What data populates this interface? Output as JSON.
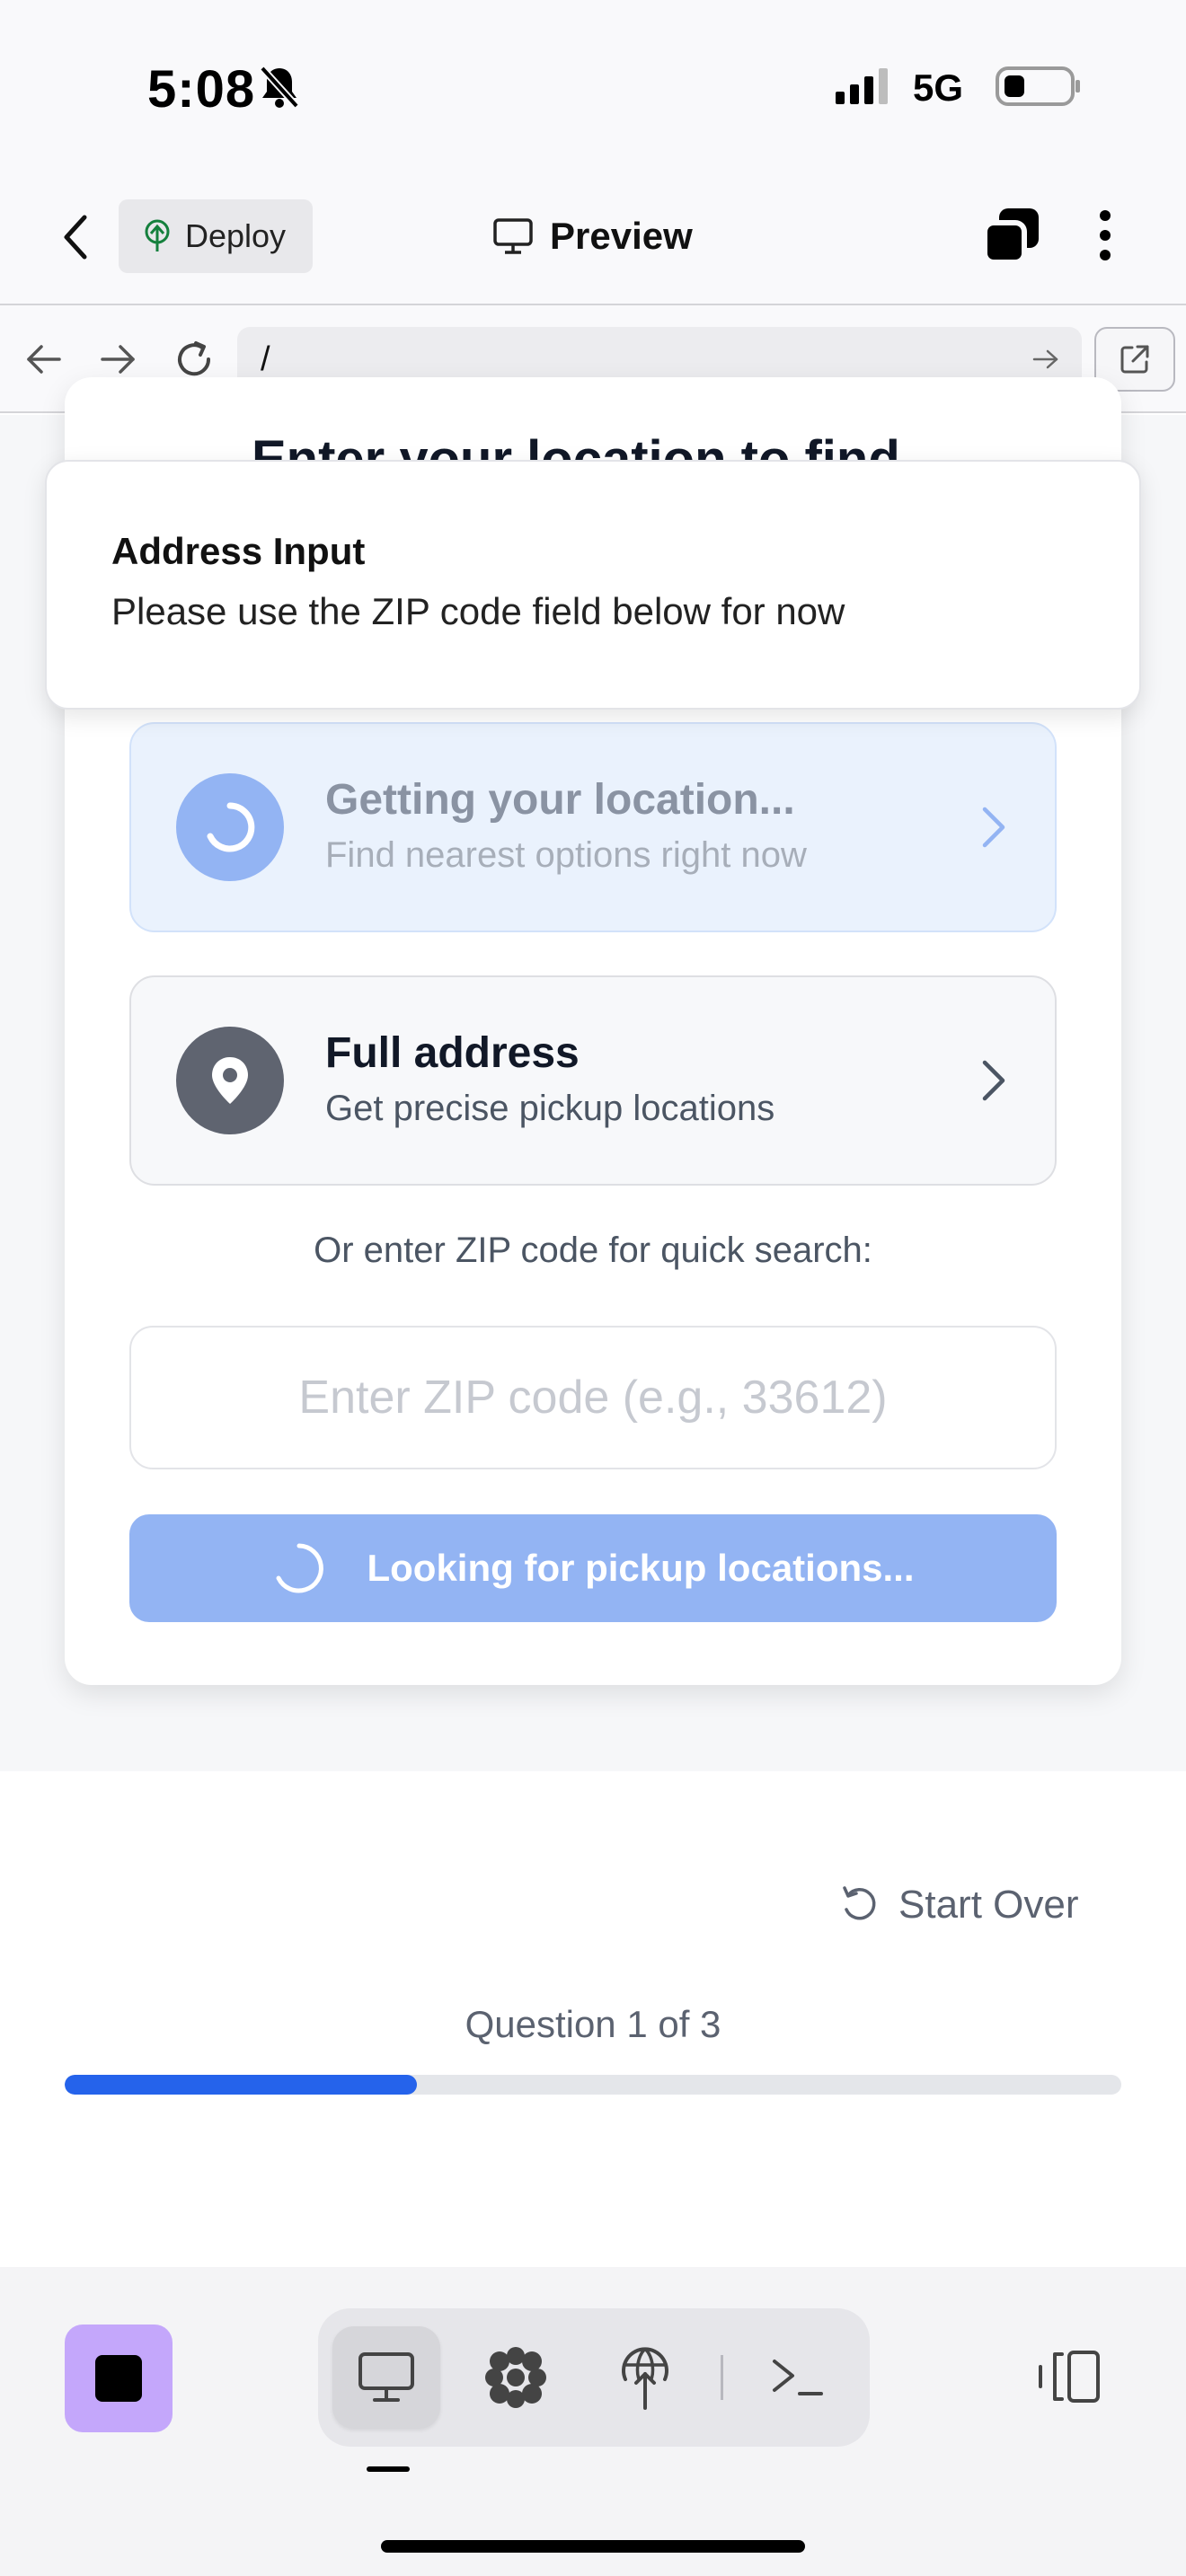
{
  "status_bar": {
    "time": "5:08",
    "network": "5G"
  },
  "header": {
    "deploy_label": "Deploy",
    "title": "Preview"
  },
  "browser": {
    "url": "/"
  },
  "card": {
    "title": "Enter your location to find",
    "geo_option": {
      "title": "Getting your location...",
      "subtitle": "Find nearest options right now"
    },
    "address_option": {
      "title": "Full address",
      "subtitle": "Get precise pickup locations"
    },
    "zip_label": "Or enter ZIP code for quick search:",
    "zip_input": {
      "value": "",
      "placeholder": "Enter ZIP code (e.g., 33612)"
    },
    "search_button_label": "Looking for pickup locations..."
  },
  "toast": {
    "title": "Address Input",
    "message": "Please use the ZIP code field below for now"
  },
  "footer": {
    "start_over_label": "Start Over",
    "question_counter": "Question 1 of 3",
    "progress_percent": 33.3
  },
  "colors": {
    "accent": "#2563eb",
    "button_disabled": "#93b4f3",
    "stop_button": "#c4a7fb"
  },
  "toolbar": {
    "icons": [
      "stop-icon",
      "monitor-icon",
      "grid-icon",
      "globe-icon",
      "terminal-icon",
      "panels-icon"
    ]
  }
}
